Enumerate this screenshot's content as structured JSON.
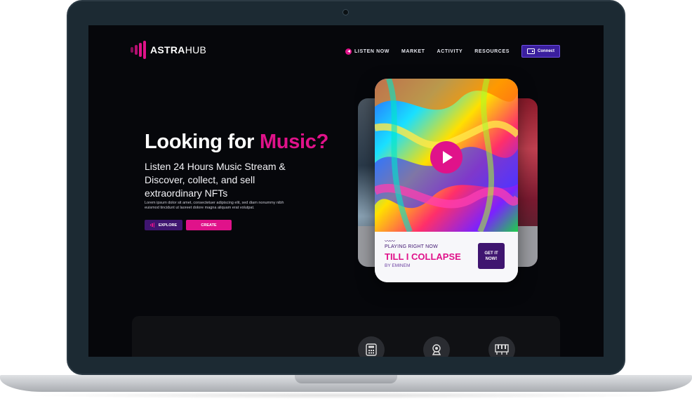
{
  "brand": {
    "name_bold": "ASTRA",
    "name_thin": "HUB",
    "accent": "#e0128a",
    "purple": "#3f1570"
  },
  "nav": {
    "items": [
      {
        "label": "LISTEN NOW",
        "icon": "speaker-icon"
      },
      {
        "label": "MARKET"
      },
      {
        "label": "ACTIVITY"
      },
      {
        "label": "RESOURCES"
      }
    ],
    "connect_label": "Connect"
  },
  "hero": {
    "title_main": "Looking for ",
    "title_accent": "Music?",
    "subtitle": "Listen 24 Hours Music Stream & Discover, collect, and sell extraordinary NFTs",
    "lorem": "Lorem ipsum dolor sit amet, consectetuer adipiscing elit, sed diam nonummy nibh euismod tincidunt ut laoreet dolore magna aliquam erat volutpat.",
    "explore_label": "EXPLORE",
    "create_label": "CREATE"
  },
  "player": {
    "wave": "〰〰",
    "playing_label": "PLAYING RIGHT NOW",
    "song": "TILL I COLLAPSE",
    "artist": "BY EMINEM",
    "cta_line1": "GET IT",
    "cta_line2": "NOW!"
  },
  "features": {
    "icons": [
      "calculator-icon",
      "webcam-icon",
      "piano-icon"
    ]
  }
}
